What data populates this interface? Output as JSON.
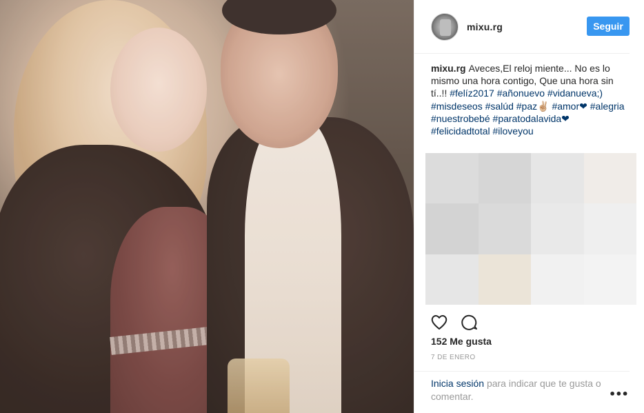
{
  "post": {
    "username": "mixu.rg",
    "follow_label": "Seguir",
    "caption": {
      "user": "mixu.rg",
      "text": "Aveces,El reloj miente... No es lo mismo una hora contigo, Que una hora sin tí..!!",
      "hashtags": [
        "#felíz2017",
        "#añonuevo",
        "#vidanueva;)",
        "#misdeseos",
        "#salúd",
        "#paz✌🏼",
        "#amor❤",
        "#alegria",
        "#nuestrobebé",
        "#paratodalavida❤",
        "#felicidadtotal",
        "#iloveyou"
      ]
    },
    "likes_label": "152 Me gusta",
    "date_label": "7 DE ENERO",
    "login": {
      "link": "Inicia sesión",
      "text": "para indicar que te gusta o comentar."
    },
    "more_label": "•••",
    "icons": {
      "like": "heart-icon",
      "comment": "comment-icon"
    }
  },
  "colors": {
    "follow_button": "#3897f0",
    "hashtag": "#003569",
    "muted": "#999999",
    "text": "#262626"
  }
}
